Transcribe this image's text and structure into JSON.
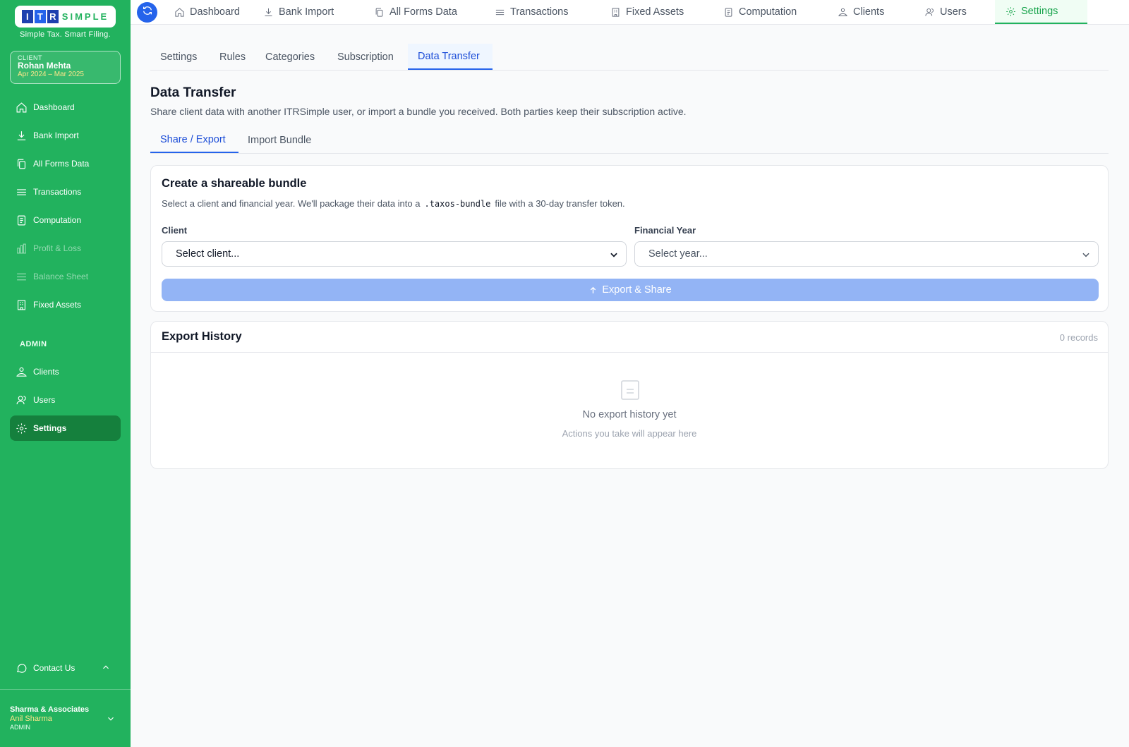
{
  "brand": {
    "logo_letters": [
      "I",
      "T",
      "R"
    ],
    "logo_word": "SIMPLE",
    "tagline": "Simple Tax. Smart Filing.",
    "colors": {
      "sidebar": "#22b25e",
      "primary": "#2563eb",
      "active_green": "#15803d"
    }
  },
  "client_card": {
    "label": "CLIENT",
    "name": "Rohan Mehta",
    "fy": "Apr 2024 – Mar 2025"
  },
  "sidebar": {
    "items": [
      {
        "label": "Dashboard",
        "icon": "home-icon"
      },
      {
        "label": "Bank Import",
        "icon": "download-icon"
      },
      {
        "label": "All Forms Data",
        "icon": "copy-icon"
      },
      {
        "label": "Transactions",
        "icon": "lines-icon"
      },
      {
        "label": "Computation",
        "icon": "document-icon"
      },
      {
        "label": "Profit & Loss",
        "icon": "chart-icon"
      },
      {
        "label": "Balance Sheet",
        "icon": "lines-icon"
      },
      {
        "label": "Fixed Assets",
        "icon": "building-icon"
      }
    ],
    "admin_label": "ADMIN",
    "admin_items": [
      {
        "label": "Clients",
        "icon": "clients-icon"
      },
      {
        "label": "Users",
        "icon": "users-icon"
      },
      {
        "label": "Settings",
        "icon": "gear-icon"
      }
    ],
    "contact": "Contact Us",
    "firm": {
      "name": "Sharma & Associates",
      "user": "Anil Sharma",
      "role": "ADMIN"
    }
  },
  "topnav": {
    "items": [
      "Dashboard",
      "Bank Import",
      "All Forms Data",
      "Transactions",
      "Fixed Assets",
      "Computation",
      "Clients",
      "Users",
      "Settings"
    ],
    "active": "Settings"
  },
  "settings_tabs": [
    "Settings",
    "Rules",
    "Categories",
    "Subscription",
    "Data Transfer"
  ],
  "page": {
    "title": "Data Transfer",
    "subtitle": "Share client data with another ITRSimple user, or import a bundle you received. Both parties keep their subscription active.",
    "sub_tabs": [
      "Share / Export",
      "Import Bundle"
    ]
  },
  "bundle": {
    "title": "Create a shareable bundle",
    "desc_pre": "Select a client and financial year. We'll package their data into a",
    "desc_code": ".taxos-bundle",
    "desc_post": "file with a 30-day transfer token.",
    "client_label": "Client",
    "client_placeholder": "Select client...",
    "fy_label": "Financial Year",
    "fy_placeholder": "Select year...",
    "button": "Export & Share"
  },
  "history": {
    "title": "Export History",
    "count": "0 records",
    "empty_title": "No export history yet",
    "empty_sub": "Actions you take will appear here"
  }
}
